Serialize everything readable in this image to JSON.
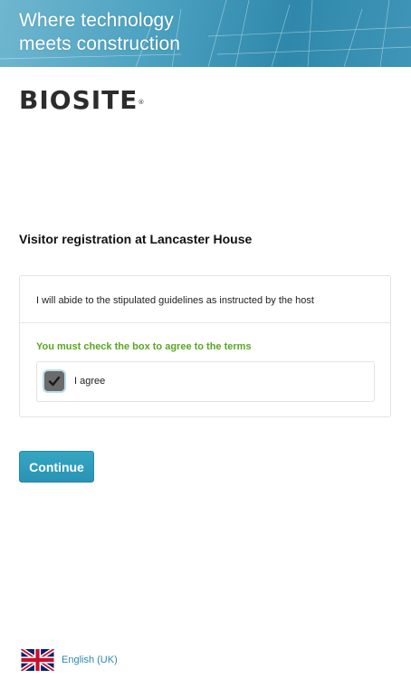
{
  "banner": {
    "tagline_line1": "Where technology",
    "tagline_line2": "meets construction"
  },
  "logo": {
    "text": "BIOSITE",
    "mark": "®"
  },
  "page_title": "Visitor registration at Lancaster House",
  "terms": {
    "statement": "I will abide to the stipulated guidelines as instructed by the host",
    "validation_message": "You must check the box to agree to the terms",
    "agree_label": "I agree",
    "agree_checked": true
  },
  "actions": {
    "continue_label": "Continue"
  },
  "footer": {
    "language_label": "English (UK)",
    "flag_icon": "uk-flag-icon"
  },
  "colors": {
    "accent": "#2a93b3",
    "validation": "#5aa623",
    "link": "#2a89ad"
  }
}
